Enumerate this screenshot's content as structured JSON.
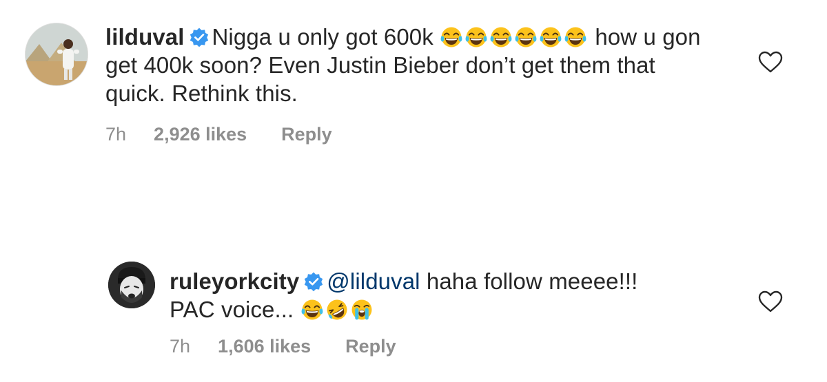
{
  "comments": [
    {
      "username": "lilduval",
      "verified": true,
      "text_line1": "Nigga u only got 600k",
      "text_rest": "how u gon get 400k soon? Even Justin Bieber don’t get them that quick. Rethink this.",
      "emojis": [
        "joy",
        "joy",
        "joy",
        "joy",
        "joy",
        "joy"
      ],
      "time": "7h",
      "likes": "2,926 likes",
      "reply_label": "Reply",
      "avatar_icon": "avatar-photo"
    },
    {
      "username": "ruleyorkcity",
      "verified": true,
      "mention": "@lilduval",
      "text_line1": "haha follow meeee!!!",
      "text_rest": "PAC voice...",
      "emojis": [
        "joy",
        "rofl",
        "sob"
      ],
      "time": "7h",
      "likes": "1,606 likes",
      "reply_label": "Reply",
      "avatar_icon": "avatar-photo"
    }
  ],
  "colors": {
    "verified_badge": "#3897f0",
    "mention": "#00376b",
    "meta_text": "#8e8e8e",
    "emoji_face": "#fcc21b",
    "tear": "#40c0e7"
  },
  "icons": {
    "like": "heart-outline-icon",
    "verified": "verified-badge-icon"
  }
}
